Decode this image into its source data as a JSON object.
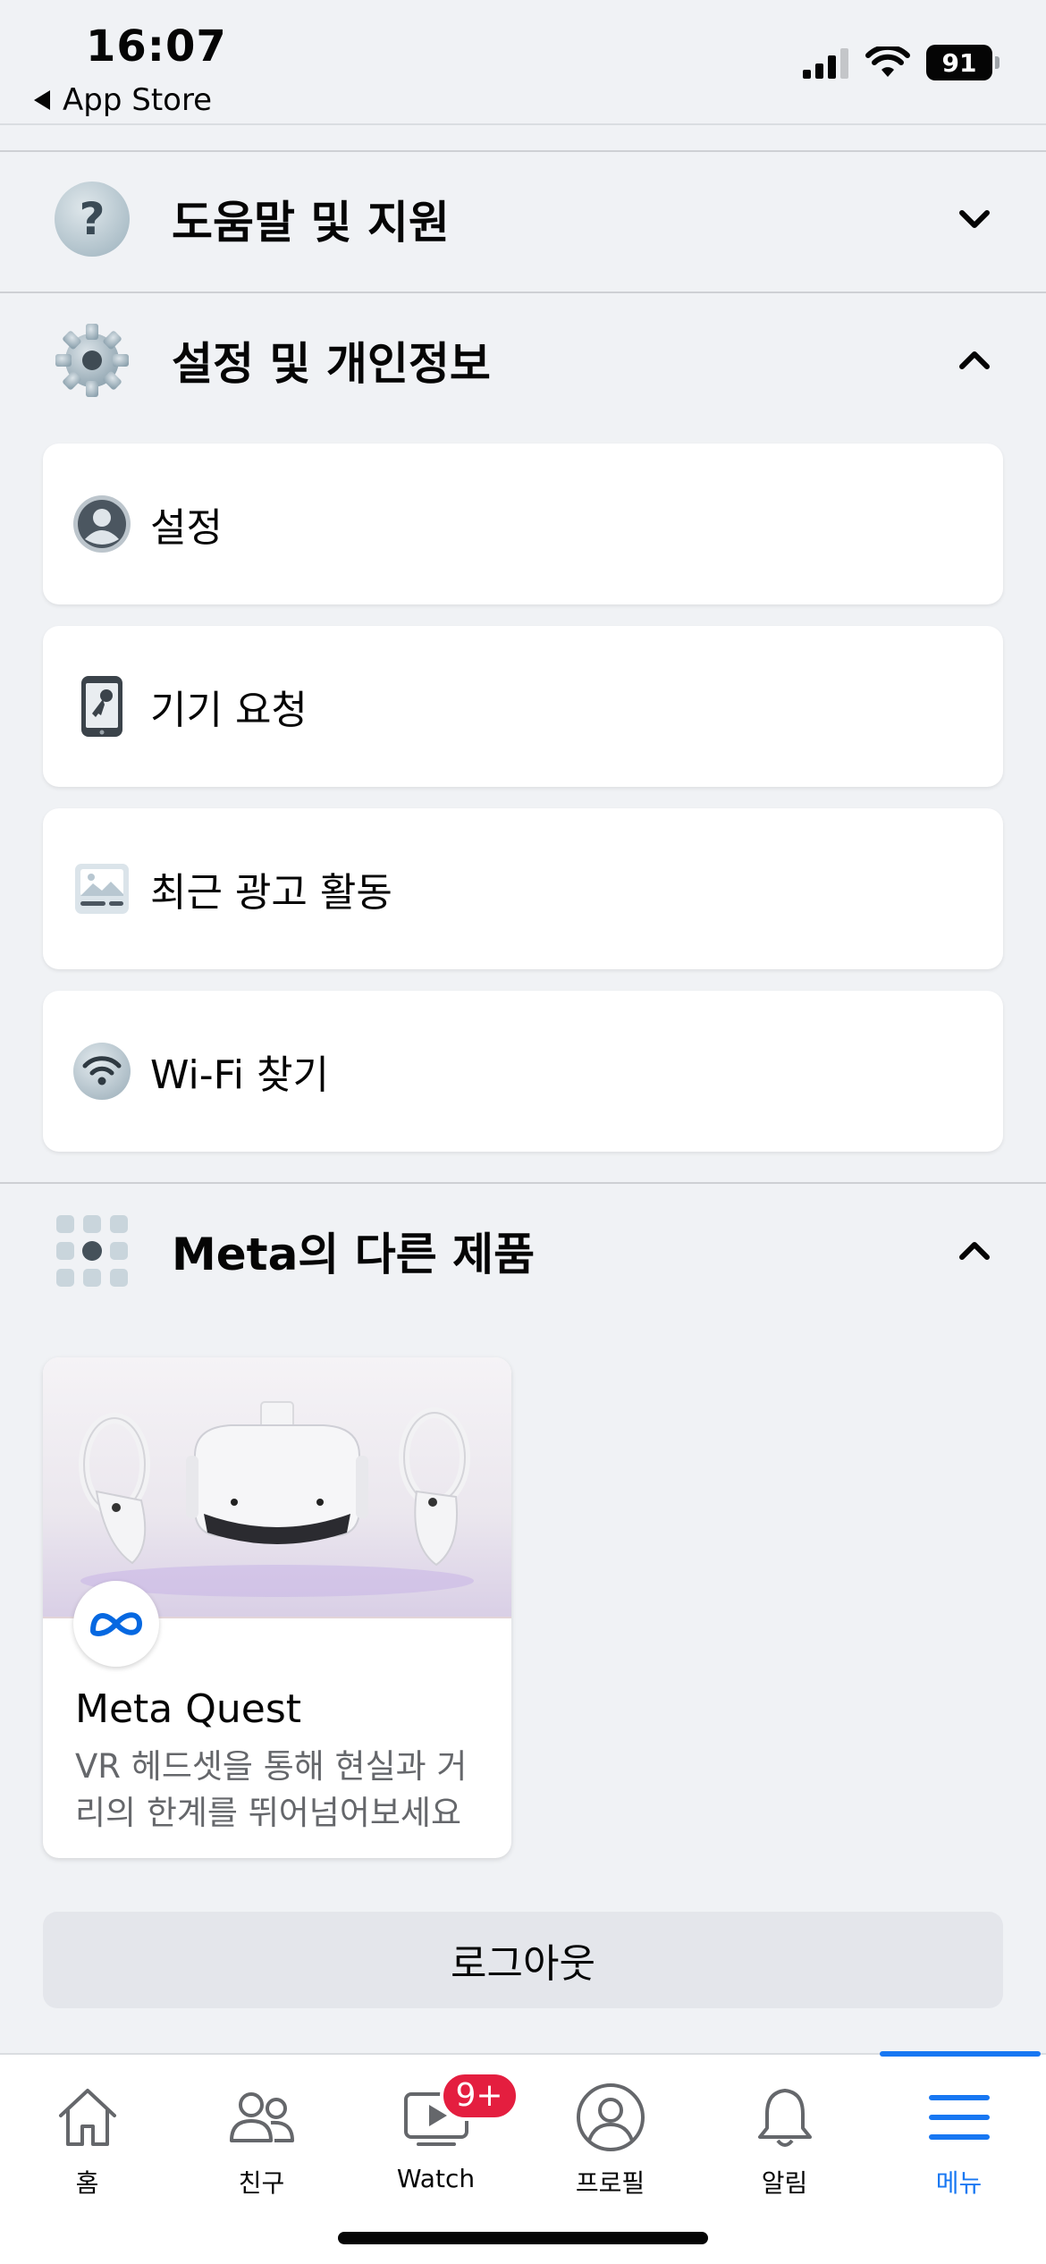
{
  "status_bar": {
    "time": "16:07",
    "back_label": "App Store",
    "battery": "91"
  },
  "sections": {
    "help": {
      "label": "도움말 및 지원"
    },
    "settings": {
      "label": "설정 및 개인정보"
    },
    "meta": {
      "label": "Meta의 다른 제품"
    }
  },
  "settings_items": [
    {
      "label": "설정"
    },
    {
      "label": "기기 요청"
    },
    {
      "label": "최근 광고 활동"
    },
    {
      "label": "Wi-Fi 찾기"
    }
  ],
  "product": {
    "title": "Meta Quest",
    "description": "VR 헤드셋을 통해 현실과 거리의 한계를 뛰어넘어보세요"
  },
  "logout_label": "로그아웃",
  "tabs": [
    {
      "label": "홈"
    },
    {
      "label": "친구"
    },
    {
      "label": "Watch",
      "badge": "9+"
    },
    {
      "label": "프로필"
    },
    {
      "label": "알림"
    },
    {
      "label": "메뉴"
    }
  ],
  "colors": {
    "accent": "#1877f2",
    "badge": "#e41e3f",
    "background": "#f0f2f5"
  }
}
